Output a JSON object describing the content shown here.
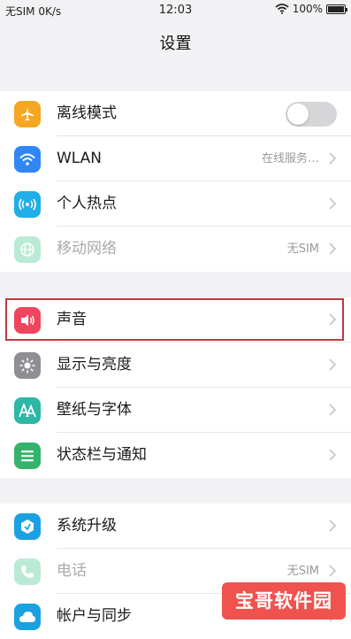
{
  "status_bar": {
    "carrier": "无SIM 0K/s",
    "time": "12:03",
    "battery_text": "100%",
    "battery_level": 100
  },
  "nav": {
    "title": "设置"
  },
  "groups": [
    {
      "rows": [
        {
          "label": "离线模式",
          "icon": "airplane-icon",
          "color": "#f5a623",
          "control": "toggle",
          "toggle_on": false
        },
        {
          "label": "WLAN",
          "icon": "wifi-icon",
          "color": "#2f86f6",
          "value": "在线服务…"
        },
        {
          "label": "个人热点",
          "icon": "hotspot-icon",
          "color": "#1faee8"
        },
        {
          "label": "移动网络",
          "icon": "globe-icon",
          "color": "#3cc68a",
          "value": "无SIM",
          "disabled": true
        }
      ]
    },
    {
      "rows": [
        {
          "label": "声音",
          "icon": "speaker-icon",
          "color": "#f0455f"
        },
        {
          "label": "显示与亮度",
          "icon": "brightness-icon",
          "color": "#8e8e93"
        },
        {
          "label": "壁纸与字体",
          "icon": "font-icon",
          "color": "#2db7a5"
        },
        {
          "label": "状态栏与通知",
          "icon": "notification-icon",
          "color": "#35b36a"
        }
      ]
    },
    {
      "rows": [
        {
          "label": "系统升级",
          "icon": "update-icon",
          "color": "#1ba1e2"
        },
        {
          "label": "电话",
          "icon": "phone-icon",
          "color": "#3cc68a",
          "value": "无SIM",
          "disabled": true
        },
        {
          "label": "帐户与同步",
          "icon": "cloud-icon",
          "color": "#1ba1e2"
        }
      ]
    }
  ],
  "watermark": {
    "text": "宝哥软件园"
  },
  "colors": {
    "highlight": "#c0393b",
    "background": "#f2f2f4"
  }
}
